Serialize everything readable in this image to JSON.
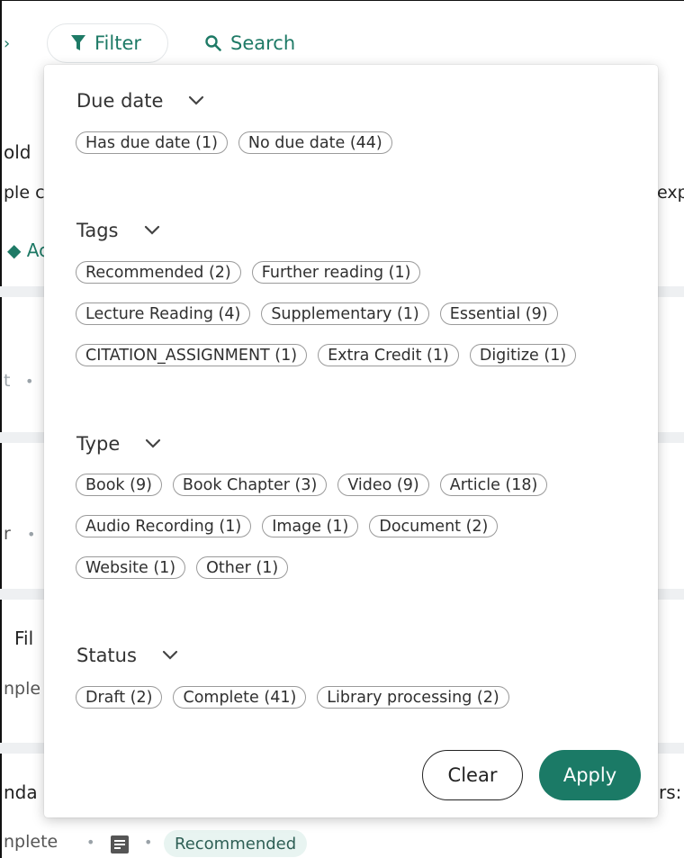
{
  "toolbar": {
    "filter_label": "Filter",
    "search_label": "Search"
  },
  "background": {
    "fragment_1": "old",
    "fragment_2": "ple c",
    "fragment_3": "exp",
    "add_label": "Ac",
    "fragment_4": "t",
    "fragment_5": "r",
    "fragment_6": "Fil",
    "fragment_7": "nple",
    "fragment_8": "nda",
    "fragment_9": "rs:",
    "status_text": "nplete",
    "tag_label": "Recommended"
  },
  "filter_panel": {
    "sections": [
      {
        "title": "Due date",
        "chips": [
          "Has due date (1)",
          "No due date (44)"
        ]
      },
      {
        "title": "Tags",
        "chips": [
          "Recommended (2)",
          "Further reading (1)",
          "Lecture Reading (4)",
          "Supplementary (1)",
          "Essential (9)",
          "CITATION_ASSIGNMENT (1)",
          "Extra Credit (1)",
          "Digitize (1)"
        ]
      },
      {
        "title": "Type",
        "chips": [
          "Book (9)",
          "Book Chapter (3)",
          "Video (9)",
          "Article (18)",
          "Audio Recording (1)",
          "Image (1)",
          "Document (2)",
          "Website (1)",
          "Other (1)"
        ]
      },
      {
        "title": "Status",
        "chips": [
          "Draft (2)",
          "Complete (41)",
          "Library processing (2)"
        ]
      }
    ],
    "clear_label": "Clear",
    "apply_label": "Apply"
  },
  "colors": {
    "accent": "#1b7a66",
    "chip_border": "#9a9a9a"
  },
  "icons": [
    "filter-icon",
    "search-icon",
    "chevron-down-icon",
    "document-icon"
  ]
}
